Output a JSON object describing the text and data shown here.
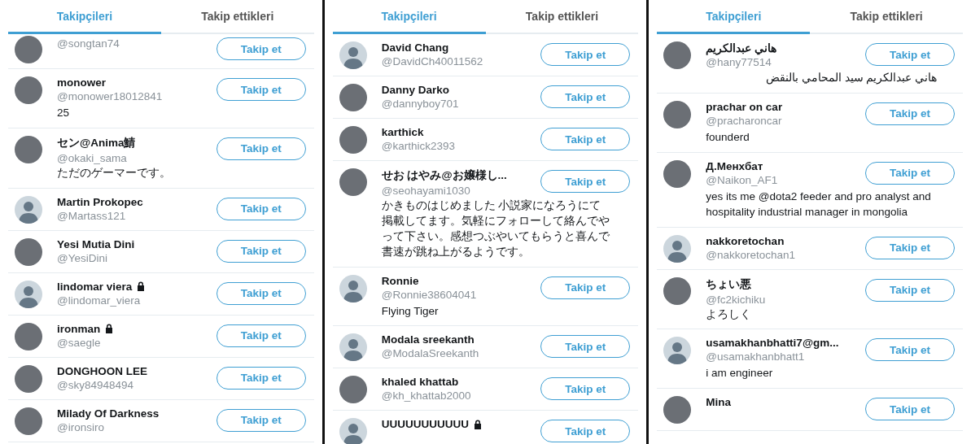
{
  "panels": [
    {
      "tabs": [
        {
          "label": "Takipçileri",
          "selected": true
        },
        {
          "label": "Takip ettikleri",
          "selected": false
        }
      ],
      "users": [
        {
          "handle": "@songtan74",
          "kind": "photo",
          "button": "Takip et"
        },
        {
          "name": "monower",
          "handle": "@monower18012841",
          "bio": "25",
          "kind": "photo",
          "button": "Takip et"
        },
        {
          "name": "セン@Anima鯖",
          "handle": "@okaki_sama",
          "bio": "ただのゲーマーです。",
          "kind": "photo",
          "button": "Takip et"
        },
        {
          "name": "Martin Prokopec",
          "handle": "@Martass121",
          "kind": "default",
          "button": "Takip et"
        },
        {
          "name": "Yesi Mutia Dini",
          "handle": "@YesiDini",
          "kind": "photo",
          "button": "Takip et"
        },
        {
          "name": "lindomar viera",
          "locked": true,
          "handle": "@lindomar_viera",
          "kind": "default",
          "button": "Takip et"
        },
        {
          "name": "ironman",
          "locked": true,
          "handle": "@saegle",
          "kind": "photo",
          "button": "Takip et"
        },
        {
          "name": "DONGHOON LEE",
          "handle": "@sky84948494",
          "kind": "photo",
          "button": "Takip et"
        },
        {
          "name": "Milady Of Darkness",
          "handle": "@ironsiro",
          "kind": "photo",
          "button": "Takip et"
        }
      ]
    },
    {
      "tabs": [
        {
          "label": "Takipçileri",
          "selected": true
        },
        {
          "label": "Takip ettikleri",
          "selected": false
        }
      ],
      "users": [
        {
          "name": "David Chang",
          "handle": "@DavidCh40011562",
          "kind": "default",
          "button": "Takip et"
        },
        {
          "name": "Danny Darko",
          "handle": "@dannyboy701",
          "kind": "photo",
          "button": "Takip et"
        },
        {
          "name": "karthick",
          "handle": "@karthick2393",
          "kind": "photo",
          "button": "Takip et"
        },
        {
          "name": "せお はやみ@お嬢様し...",
          "handle": "@seohayami1030",
          "bio": "かきものはじめました 小説家になろうにて掲載してます。気軽にフォローして絡んでやって下さい。感想つぶやいてもらうと喜んで書速が跳ね上がるようです。",
          "kind": "photo",
          "button": "Takip et"
        },
        {
          "name": "Ronnie",
          "handle": "@Ronnie38604041",
          "bio": "Flying Tiger",
          "kind": "default",
          "button": "Takip et"
        },
        {
          "name": "Modala sreekanth",
          "handle": "@ModalaSreekanth",
          "kind": "default",
          "button": "Takip et"
        },
        {
          "name": "khaled khattab",
          "handle": "@kh_khattab2000",
          "kind": "photo",
          "button": "Takip et"
        },
        {
          "name": "UUUUUUUUUUU",
          "locked": true,
          "kind": "default",
          "button": "Takip et"
        }
      ]
    },
    {
      "tabs": [
        {
          "label": "Takipçileri",
          "selected": true
        },
        {
          "label": "Takip ettikleri",
          "selected": false
        }
      ],
      "users": [
        {
          "name": "هاني عبدالكريم",
          "handle": "@hany77514",
          "bio": "هاني عبدالكريم سيد المحامي بالنقض",
          "bio_rtl": true,
          "kind": "photo",
          "button": "Takip et"
        },
        {
          "name": "prachar on car",
          "handle": "@pracharoncar",
          "bio": "founderd",
          "kind": "photo",
          "button": "Takip et"
        },
        {
          "name": "Д.Менхбат",
          "handle": "@Naikon_AF1",
          "bio": "yes its me @dota2 feeder and pro analyst and hospitality industrial manager in mongolia",
          "kind": "photo",
          "button": "Takip et"
        },
        {
          "name": "nakkoretochan",
          "handle": "@nakkoretochan1",
          "kind": "default",
          "button": "Takip et"
        },
        {
          "name": "ちょい悪",
          "handle": "@fc2kichiku",
          "bio": "よろしく",
          "kind": "photo",
          "button": "Takip et"
        },
        {
          "name": "usamakhanbhatti7@gm...",
          "handle": "@usamakhanbhatt1",
          "bio": "i am engineer",
          "kind": "default",
          "button": "Takip et"
        },
        {
          "name": "Mina",
          "kind": "photo",
          "button": "Takip et"
        }
      ]
    }
  ]
}
